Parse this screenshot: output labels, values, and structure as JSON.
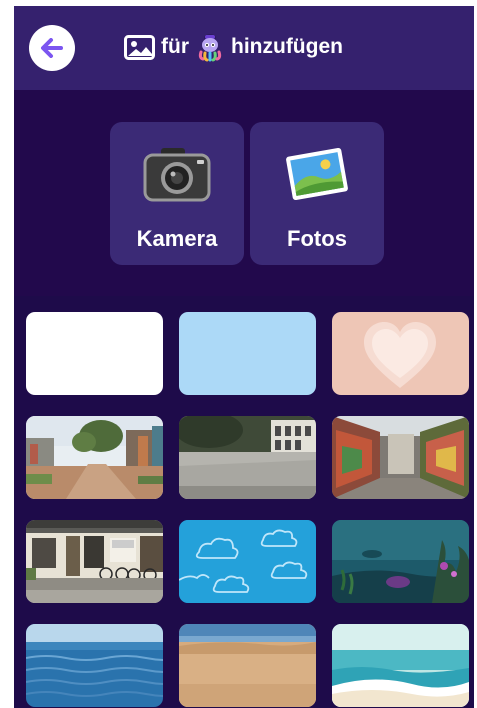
{
  "header": {
    "title_prefix": "für",
    "title_suffix": "hinzufügen",
    "back_icon": "arrow-left-icon",
    "title_icon": "image-icon",
    "mascot_icon": "octopus-mascot-icon"
  },
  "sources": [
    {
      "label": "Kamera",
      "icon": "camera-icon"
    },
    {
      "label": "Fotos",
      "icon": "photos-icon"
    }
  ],
  "backgrounds": [
    {
      "name": "white-background",
      "color": "#ffffff"
    },
    {
      "name": "light-blue-background",
      "color": "#acd9f7"
    },
    {
      "name": "heart-background",
      "color": "#eec6b6"
    },
    {
      "name": "village-street-photo"
    },
    {
      "name": "courtyard-photo"
    },
    {
      "name": "graffiti-alley-photo"
    },
    {
      "name": "house-with-bicycles-photo"
    },
    {
      "name": "cloud-doodle-background"
    },
    {
      "name": "underwater-background"
    },
    {
      "name": "ocean-photo"
    },
    {
      "name": "beach-photo"
    },
    {
      "name": "sea-waves-background"
    }
  ],
  "colors": {
    "header": "#35216e",
    "panel": "#22094c",
    "button": "#3b2a76",
    "accent": "#7b55f0"
  }
}
